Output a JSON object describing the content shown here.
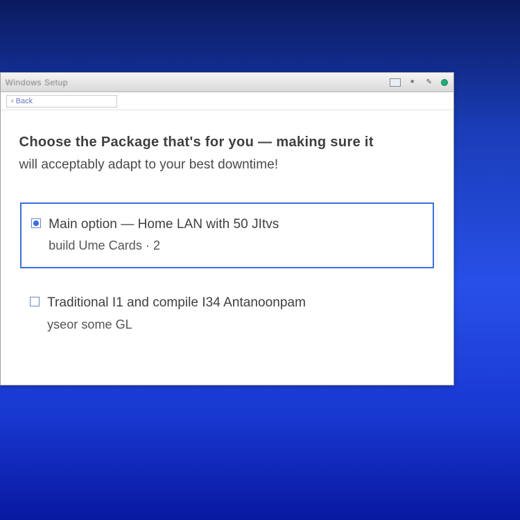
{
  "window": {
    "title": "Windows Setup",
    "toolbar_text": "‹ Back"
  },
  "page": {
    "heading_line1": "Choose the Package that's for you — making sure it",
    "heading_line2": "will acceptably adapt to your best downtime!"
  },
  "options": [
    {
      "title": "Main option — Home LAN with 50 JItvs",
      "subtitle": "build Ume Cards · 2",
      "selected": true
    },
    {
      "title": "Traditional I1 and compile I34 Antanoonpam",
      "subtitle": "yseor some GL",
      "selected": false
    }
  ],
  "titlebar_icons": [
    "window-state-icon",
    "feed-icon",
    "tool-icon",
    "status-dot-icon"
  ]
}
